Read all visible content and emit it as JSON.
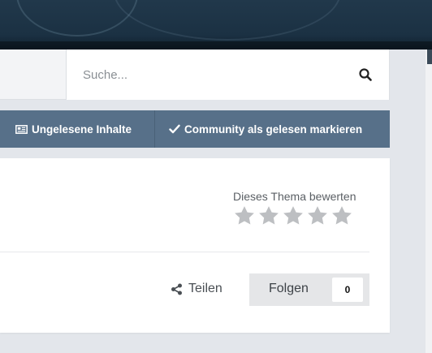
{
  "search": {
    "placeholder": "Suche...",
    "icon": "search-icon"
  },
  "actions": {
    "unread_label": "Ungelesene Inhalte",
    "unread_icon": "newspaper-icon",
    "mark_read_label": "Community als gelesen markieren",
    "mark_read_icon": "check-icon"
  },
  "rating": {
    "label": "Dieses Thema bewerten",
    "stars_total": 5,
    "stars_filled": 0
  },
  "share": {
    "label": "Teilen",
    "icon": "share-icon"
  },
  "follow": {
    "label": "Folgen",
    "count": "0"
  },
  "colors": {
    "action_bar": "#577089",
    "page_background": "#e3e6eb",
    "star_empty": "#bdbfc2"
  }
}
